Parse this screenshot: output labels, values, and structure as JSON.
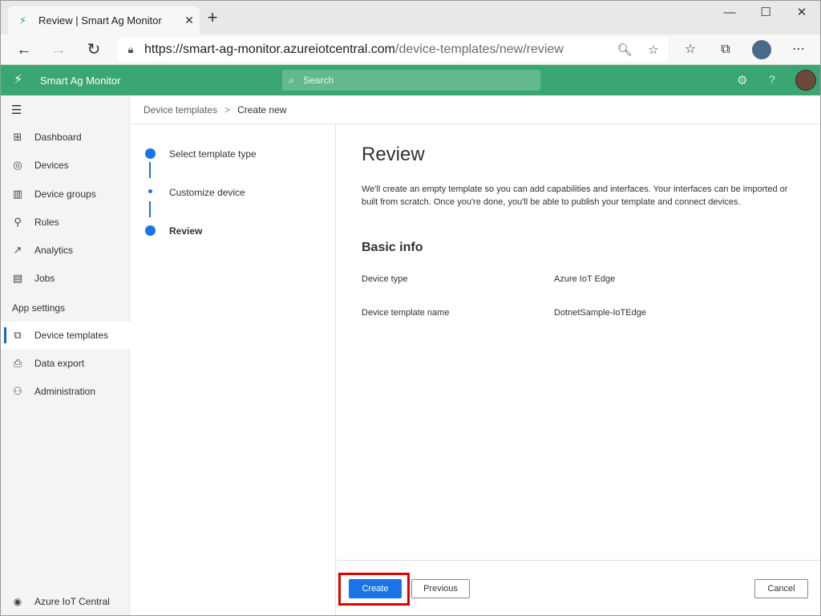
{
  "browser": {
    "tab_title": "Review | Smart Ag Monitor",
    "url_main": "https://smart-ag-monitor.azureiotcentral.com",
    "url_path": "/device-templates/new/review",
    "new_tab_glyph": "+",
    "close_tab_glyph": "✕",
    "minimize_glyph": "—",
    "maximize_glyph": "☐",
    "close_window_glyph": "✕"
  },
  "app": {
    "name": "Smart Ag Monitor",
    "search_placeholder": "Search",
    "accent_color": "#3aa672"
  },
  "nav": {
    "items": [
      {
        "label": "Dashboard",
        "icon": "dashboard-icon"
      },
      {
        "label": "Devices",
        "icon": "devices-icon"
      },
      {
        "label": "Device groups",
        "icon": "device-groups-icon"
      },
      {
        "label": "Rules",
        "icon": "rules-icon"
      },
      {
        "label": "Analytics",
        "icon": "analytics-icon"
      },
      {
        "label": "Jobs",
        "icon": "jobs-icon"
      }
    ],
    "section_label": "App settings",
    "settings_items": [
      {
        "label": "Device templates",
        "icon": "device-templates-icon",
        "active": true
      },
      {
        "label": "Data export",
        "icon": "data-export-icon"
      },
      {
        "label": "Administration",
        "icon": "administration-icon"
      }
    ],
    "footer_label": "Azure IoT Central"
  },
  "breadcrumb": {
    "parent": "Device templates",
    "current": "Create new"
  },
  "steps": [
    {
      "label": "Select template type"
    },
    {
      "label": "Customize device"
    },
    {
      "label": "Review"
    }
  ],
  "review": {
    "title": "Review",
    "description": "We'll create an empty template so you can add capabilities and interfaces. Your interfaces can be imported or built from scratch. Once you're done, you'll be able to publish your template and connect devices.",
    "section_title": "Basic info",
    "rows": [
      {
        "label": "Device type",
        "value": "Azure IoT Edge"
      },
      {
        "label": "Device template name",
        "value": "DotnetSample-IoTEdge"
      }
    ]
  },
  "footer": {
    "create_label": "Create",
    "previous_label": "Previous",
    "cancel_label": "Cancel",
    "highlight_color": "#e00000"
  }
}
